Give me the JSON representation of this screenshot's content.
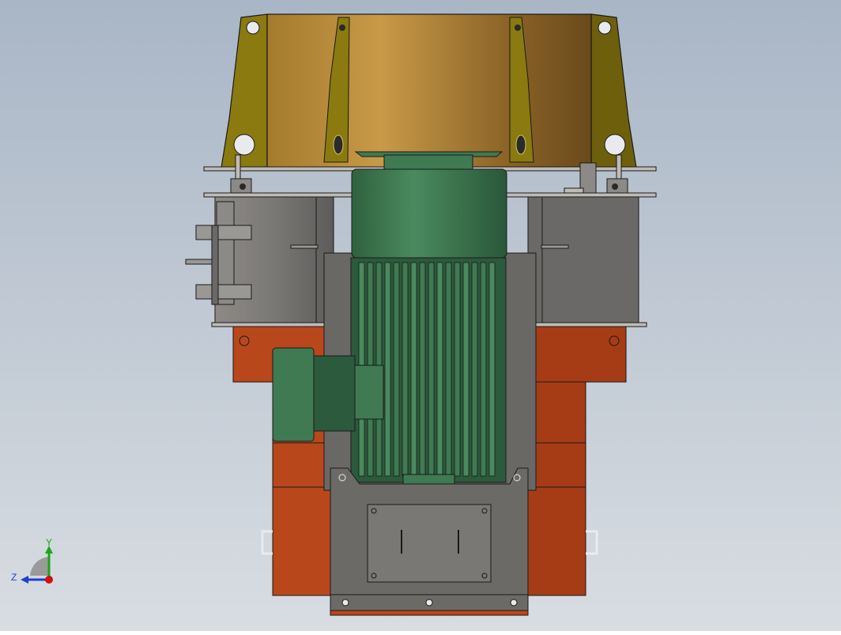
{
  "viewport": {
    "background_top": "#a9b6c6",
    "background_bottom": "#d8dde2"
  },
  "colors": {
    "bracket_yellow": "#8a7a10",
    "hood_gold": "#b58a3c",
    "hood_shadow": "#7a5a22",
    "housing_gray": "#7d7b78",
    "housing_dark": "#5b5a58",
    "base_orange": "#b9471c",
    "base_orange_dark": "#8f3310",
    "motor_green": "#3f7a52",
    "motor_green_dark": "#2c5a3c",
    "plate_gray": "#6c6a66",
    "edge": "#1a1a1a"
  },
  "triad": {
    "y_label": "Y",
    "z_label": "Z",
    "y_color": "#19a619",
    "z_color": "#1f3fd0",
    "origin_color": "#d41010"
  }
}
